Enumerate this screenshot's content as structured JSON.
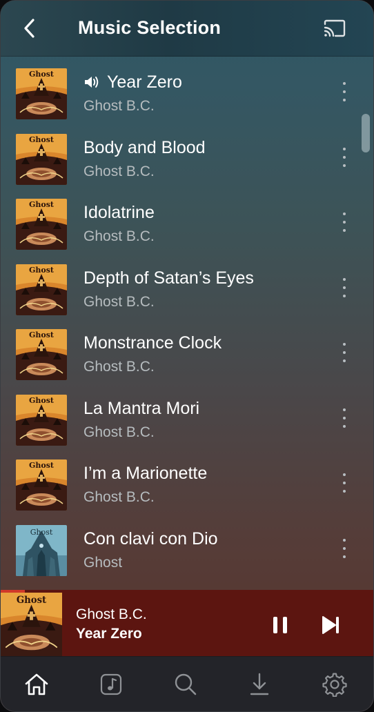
{
  "header": {
    "title": "Music Selection",
    "back_icon": "chevron-left-icon",
    "cast_icon": "cast-icon"
  },
  "songs": [
    {
      "title": "Year Zero",
      "artist": "Ghost B.C.",
      "album_art": "ghost-bc-infestissumam",
      "now_playing": true
    },
    {
      "title": "Body and Blood",
      "artist": "Ghost B.C.",
      "album_art": "ghost-bc-infestissumam",
      "now_playing": false
    },
    {
      "title": "Idolatrine",
      "artist": "Ghost B.C.",
      "album_art": "ghost-bc-infestissumam",
      "now_playing": false
    },
    {
      "title": "Depth of Satan’s Eyes",
      "artist": "Ghost B.C.",
      "album_art": "ghost-bc-infestissumam",
      "now_playing": false
    },
    {
      "title": "Monstrance Clock",
      "artist": "Ghost B.C.",
      "album_art": "ghost-bc-infestissumam",
      "now_playing": false
    },
    {
      "title": "La Mantra Mori",
      "artist": "Ghost B.C.",
      "album_art": "ghost-bc-infestissumam",
      "now_playing": false
    },
    {
      "title": "I’m a Marionette",
      "artist": "Ghost B.C.",
      "album_art": "ghost-bc-infestissumam",
      "now_playing": false
    },
    {
      "title": "Con clavi con Dio",
      "artist": "Ghost",
      "album_art": "ghost-opus-eponymous",
      "now_playing": false
    }
  ],
  "now_playing": {
    "artist": "Ghost B.C.",
    "title": "Year Zero",
    "progress": 0.065,
    "pause_icon": "pause-icon",
    "next_icon": "skip-next-icon"
  },
  "bottom_nav": [
    {
      "name": "home",
      "icon": "home-icon",
      "active": true
    },
    {
      "name": "library",
      "icon": "music-note-icon",
      "active": false
    },
    {
      "name": "search",
      "icon": "search-icon",
      "active": false
    },
    {
      "name": "downloads",
      "icon": "download-icon",
      "active": false
    },
    {
      "name": "settings",
      "icon": "gear-icon",
      "active": false
    }
  ],
  "colors": {
    "accent": "#d13a2a",
    "mini_player_bg": "#5c1510",
    "nav_bg": "#232429",
    "secondary_text": "#b6bcbf"
  }
}
